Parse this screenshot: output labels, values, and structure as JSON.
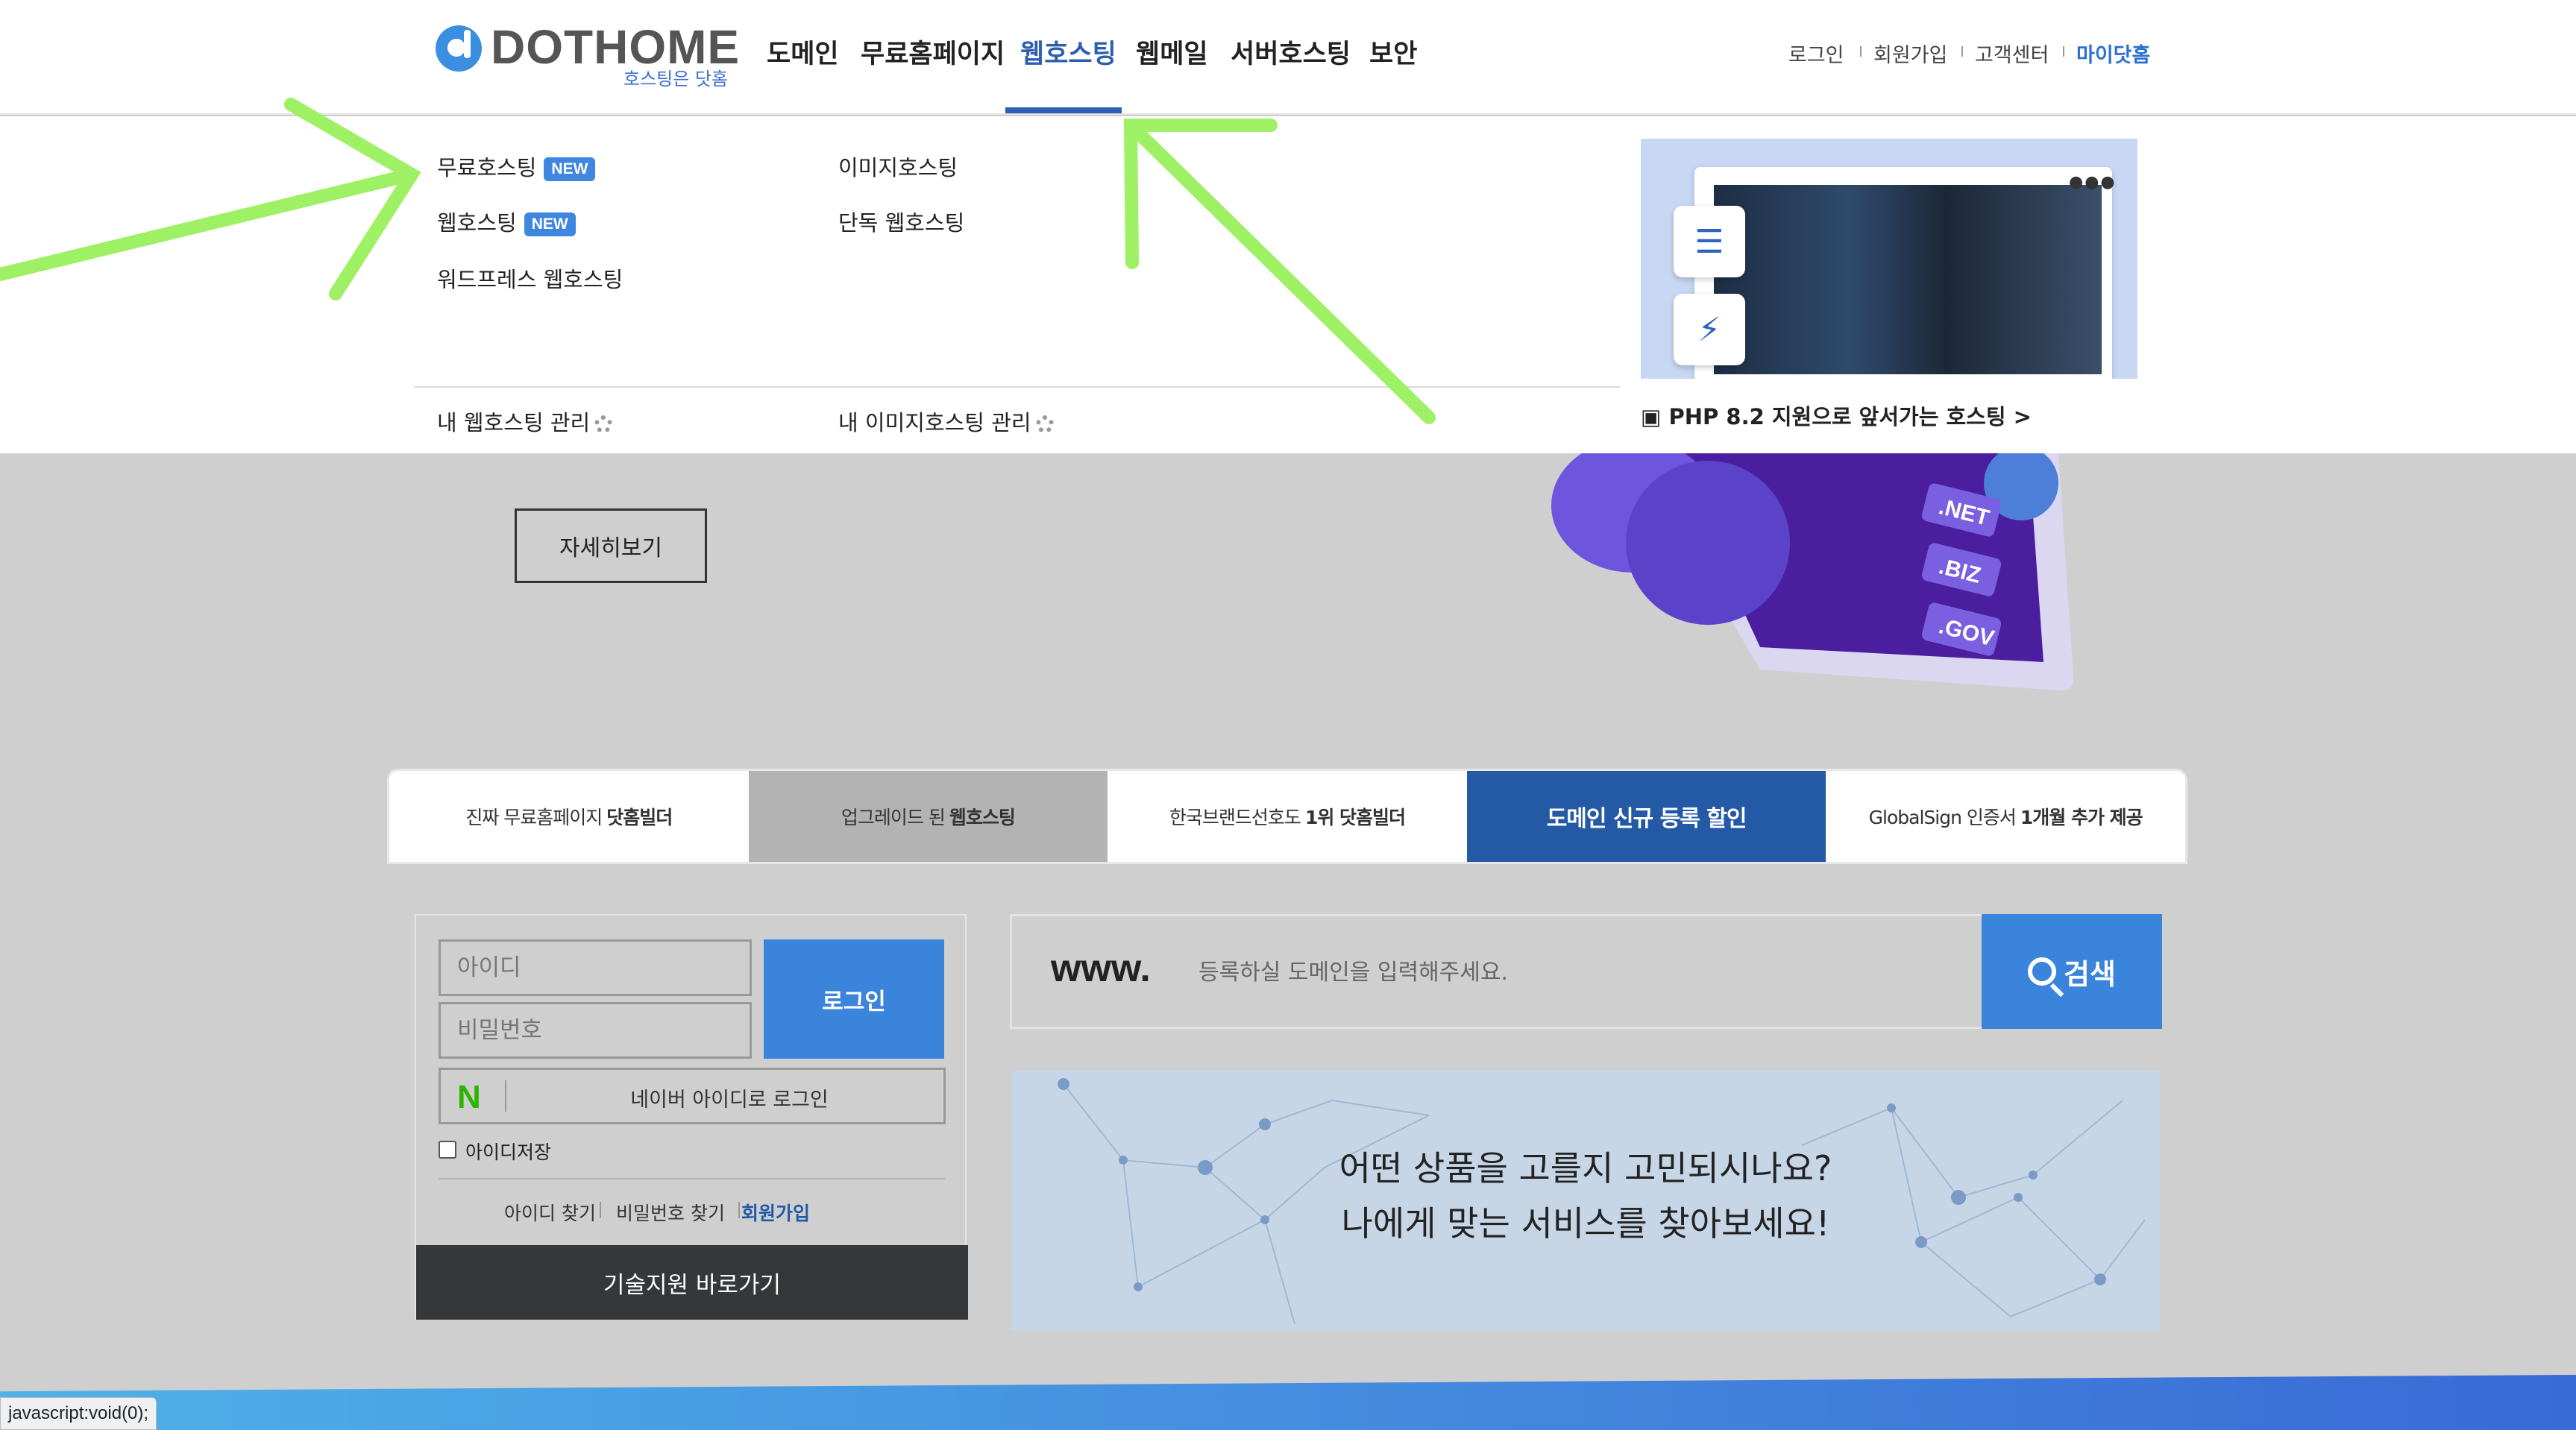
{
  "header": {
    "logo_text": "DOTHOME",
    "logo_sub": "호스팅은 닷홈",
    "nav": [
      "도메인",
      "무료홈페이지",
      "웹호스팅",
      "웹메일",
      "서버호스팅",
      "보안"
    ],
    "active_nav": "웹호스팅",
    "util_links": [
      "로그인",
      "회원가입",
      "고객센터",
      "마이닷홈"
    ]
  },
  "dropdown": {
    "col1": [
      {
        "label": "무료호스팅",
        "badge": "NEW"
      },
      {
        "label": "웹호스팅",
        "badge": "NEW"
      },
      {
        "label": "워드프레스 웹호스팅"
      }
    ],
    "col2": [
      {
        "label": "이미지호스팅"
      },
      {
        "label": "단독 웹호스팅"
      }
    ],
    "manage_web": "내 웹호스팅 관리",
    "manage_image": "내 이미지호스팅 관리",
    "promo_caption": "PHP 8.2 지원으로 앞서가는 호스팅 >"
  },
  "hero": {
    "detail_button": "자세히보기",
    "art_labels": [
      ".NET",
      ".BIZ",
      ".GOV"
    ]
  },
  "tabs": [
    {
      "text": "진짜 무료홈페이지",
      "bold": "닷홈빌더"
    },
    {
      "text": "업그레이드 된",
      "bold": "웹호스팅"
    },
    {
      "text": "한국브랜드선호도",
      "bold": "1위 닷홈빌더"
    },
    {
      "text": "",
      "bold": "도메인 신규 등록 할인"
    },
    {
      "text": "GlobalSign 인증서",
      "bold": "1개월 추가 제공"
    }
  ],
  "login": {
    "id_placeholder": "아이디",
    "pw_placeholder": "비밀번호",
    "login_button": "로그인",
    "naver_button": "네이버 아이디로 로그인",
    "save_id": "아이디저장",
    "find_id": "아이디 찾기",
    "find_pw": "비밀번호 찾기",
    "signup": "회원가입",
    "support": "기술지원  바로가기"
  },
  "domain_search": {
    "prefix": "www.",
    "placeholder": "등록하실 도메인을 입력해주세요.",
    "button": "검색"
  },
  "banner": {
    "line1": "어떤 상품을 고를지 고민되시나요?",
    "line2": "나에게 맞는 서비스를 찾아보세요!"
  },
  "status_bar": "javascript:void(0);",
  "colors": {
    "brand_blue": "#2c5fb0",
    "button_blue": "#3b84dc",
    "annotation_green": "#9ef064",
    "naver_green": "#2db400"
  }
}
